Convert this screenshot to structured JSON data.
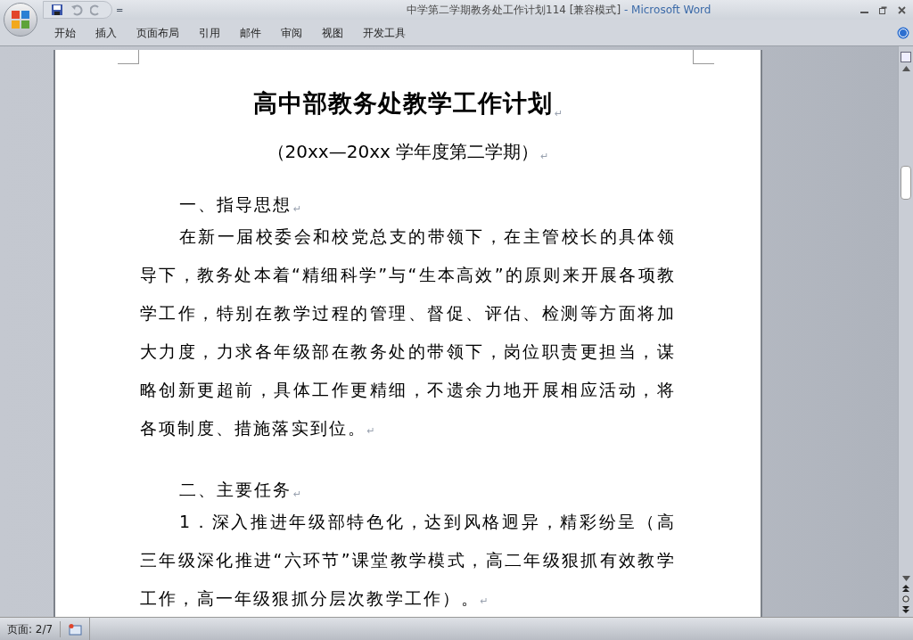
{
  "window": {
    "title": "中学第二学期教务处工作计划114 [兼容模式]",
    "app": " - Microsoft Word"
  },
  "quick_access": {
    "menu_glyph": "="
  },
  "ribbon_tabs": [
    {
      "label": "开始",
      "selected": false
    },
    {
      "label": "插入",
      "selected": false
    },
    {
      "label": "页面布局",
      "selected": false
    },
    {
      "label": "引用",
      "selected": false
    },
    {
      "label": "邮件",
      "selected": false
    },
    {
      "label": "审阅",
      "selected": false
    },
    {
      "label": "视图",
      "selected": false
    },
    {
      "label": "开发工具",
      "selected": false
    }
  ],
  "document": {
    "paragraphs": [
      {
        "kind": "title",
        "text": "高中部教务处教学工作计划",
        "mark": "↵"
      },
      {
        "kind": "subtitle",
        "text": "（20xx—20xx 学年度第二学期）",
        "mark": "↵"
      },
      {
        "kind": "heading",
        "text": "一、指导思想",
        "mark": "↵"
      },
      {
        "kind": "body",
        "text": "在新一届校委会和校党总支的带领下，在主管校长的具体领导下，教务处本着“精细科学”与“生本高效”的原则来开展各项教学工作，特别在教学过程的管理、督促、评估、检测等方面将加大力度，力求各年级部在教务处的带领下，岗位职责更担当，谋略创新更超前，具体工作更精细，不遗余力地开展相应活动，将各项制度、措施落实到位。",
        "mark": "↵"
      },
      {
        "kind": "heading",
        "text": "二、主要任务",
        "mark": "↵"
      },
      {
        "kind": "body",
        "text": "1．深入推进年级部特色化，达到风格迥异，精彩纷呈（高三年级深化推进“六环节”课堂教学模式，高二年级狠抓有效教学工作，高一年级狠抓分层次教学工作）。",
        "mark": "↵"
      }
    ]
  },
  "status_bar": {
    "page": "页面: 2/7"
  }
}
